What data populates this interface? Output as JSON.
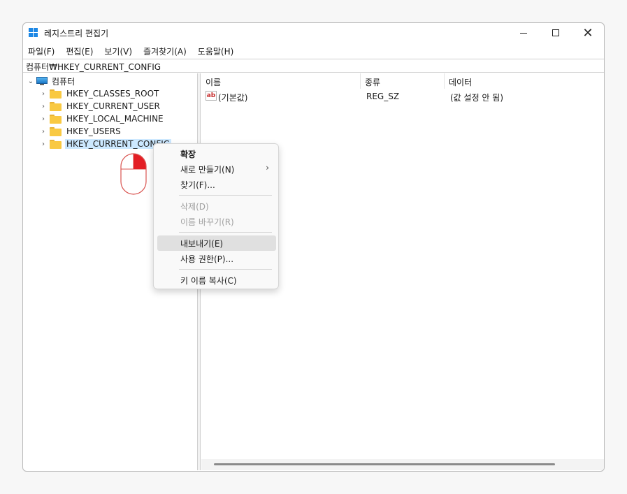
{
  "window": {
    "title": "레지스트리 편집기"
  },
  "menubar": {
    "items": [
      "파일(F)",
      "편집(E)",
      "보기(V)",
      "즐겨찾기(A)",
      "도움말(H)"
    ]
  },
  "addressbar": {
    "path": "컴퓨터₩HKEY_CURRENT_CONFIG"
  },
  "tree": {
    "root": "컴퓨터",
    "hives": [
      "HKEY_CLASSES_ROOT",
      "HKEY_CURRENT_USER",
      "HKEY_LOCAL_MACHINE",
      "HKEY_USERS",
      "HKEY_CURRENT_CONFIG"
    ],
    "selected": "HKEY_CURRENT_CONFIG"
  },
  "list": {
    "columns": [
      "이름",
      "종류",
      "데이터"
    ],
    "rows": [
      {
        "name": "(기본값)",
        "type": "REG_SZ",
        "data": "(값 설정 안 됨)",
        "icon": "string-value-icon"
      }
    ]
  },
  "context_menu": {
    "expand": "확장",
    "new": "새로 만들기(N)",
    "find": "찾기(F)...",
    "delete": "삭제(D)",
    "rename": "이름 바꾸기(R)",
    "export": "내보내기(E)",
    "permissions": "사용 권한(P)...",
    "copy_key_name": "키 이름 복사(C)",
    "hovered": "내보내기(E)"
  },
  "colors": {
    "selection": "#cce8ff",
    "menu_hover": "#e0e0e0",
    "mouse_right_button": "#e31e24"
  }
}
